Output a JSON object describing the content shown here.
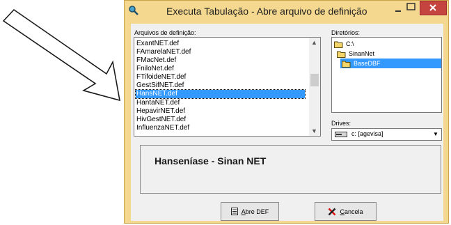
{
  "window": {
    "title": "Executa Tabulação - Abre arquivo de definição"
  },
  "files": {
    "label": "Arquivos de definição:",
    "items": [
      "ExantNET.def",
      "FAmarelaNET.def",
      "FMacNet.def",
      "FniloNet.def",
      "FTifoideNET.def",
      "GestSifNET.def",
      "HansNET.def",
      "HantaNET.def",
      "HepavirNET.def",
      "HivGestNET.def",
      "InfluenzaNET.def"
    ],
    "selected_index": 6
  },
  "dirs": {
    "label": "Diretórios:",
    "items": [
      "C:\\",
      "SinanNet",
      "BaseDBF"
    ],
    "selected_index": 2
  },
  "drives": {
    "label": "Drives:",
    "value": "c: [agevisa]"
  },
  "info": {
    "text": "Hanseníase - Sinan NET"
  },
  "buttons": {
    "open_prefix": "A",
    "open_rest": "bre DEF",
    "cancel_prefix": "C",
    "cancel_rest": "ancela"
  },
  "icons": {
    "app": "magnifier-icon",
    "folder": "folder-icon",
    "drive": "drive-icon",
    "open": "document-icon",
    "cancel": "x-icon"
  },
  "colors": {
    "window_bg": "#f5d88f",
    "selection": "#3399ff",
    "close": "#c6443f"
  }
}
